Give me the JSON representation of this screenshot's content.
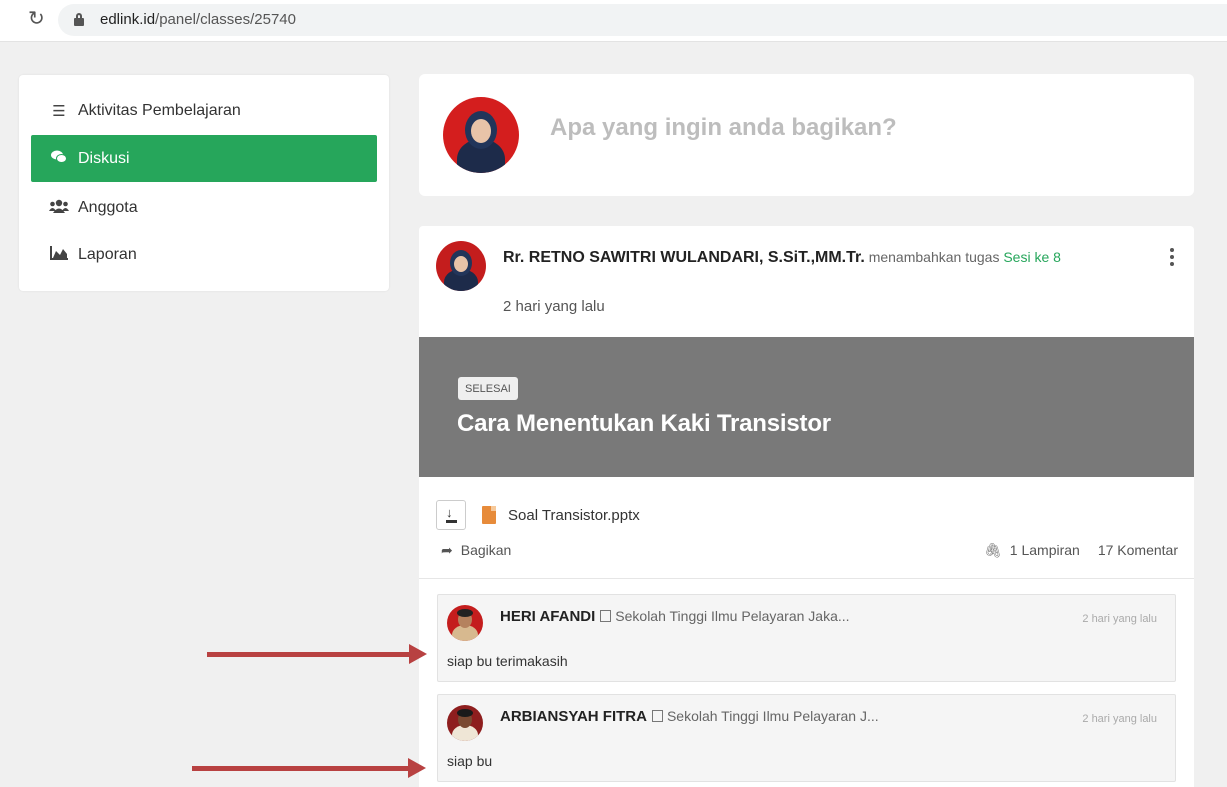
{
  "browser": {
    "reload_icon": "reload-icon",
    "url_host": "edlink.id",
    "url_path": "/panel/classes/25740"
  },
  "sidebar": {
    "items": [
      {
        "label": "Aktivitas Pembelajaran",
        "icon": "checklist-icon",
        "active": false
      },
      {
        "label": "Diskusi",
        "icon": "comments-icon",
        "active": true
      },
      {
        "label": "Anggota",
        "icon": "users-icon",
        "active": false
      },
      {
        "label": "Laporan",
        "icon": "area-chart-icon",
        "active": false
      }
    ]
  },
  "composer": {
    "placeholder": "Apa yang ingin anda bagikan?"
  },
  "post": {
    "author": "Rr. RETNO SAWITRI WULANDARI, S.SiT.,MM.Tr.",
    "action": "menambahkan tugas",
    "session": "Sesi ke 8",
    "time": "2 hari yang lalu",
    "status_badge": "SELESAI",
    "title": "Cara Menentukan Kaki Transistor",
    "attachment_name": "Soal Transistor.pptx",
    "share_label": "Bagikan",
    "attachments_count": "1 Lampiran",
    "comments_count": "17 Komentar"
  },
  "comments": [
    {
      "name": "HERI AFANDI",
      "school": "Sekolah Tinggi Ilmu Pelayaran Jaka...",
      "time": "2 hari yang lalu",
      "text": "siap bu terimakasih"
    },
    {
      "name": "ARBIANSYAH FITRA",
      "school": "Sekolah Tinggi Ilmu Pelayaran J...",
      "time": "2 hari yang lalu",
      "text": "siap bu"
    }
  ],
  "colors": {
    "accent_green": "#26a65b",
    "banner_gray": "#797979",
    "annotation_arrow": "#b84141"
  }
}
